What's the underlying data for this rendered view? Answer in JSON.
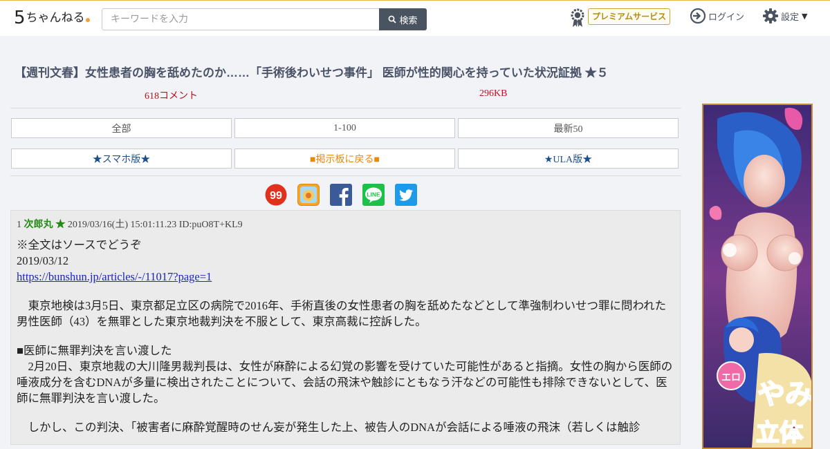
{
  "header": {
    "logo_text": "ちゃんねる",
    "logo_number": "5",
    "search_placeholder": "キーワードを入力",
    "search_button": "検索",
    "premium_label": "プレミアムサービス",
    "login_label": "ログイン",
    "settings_label": "設定"
  },
  "thread": {
    "title": "【週刊文春】女性患者の胸を舐めたのか……「手術後わいせつ事件」 医師が性的関心を持っていた状況証拠 ★５",
    "comments": "618コメント",
    "size": "296KB"
  },
  "nav": {
    "row1": [
      "全部",
      "1-100",
      "最新50"
    ],
    "row2": [
      "★スマホ版★",
      "■掲示板に戻る■",
      "★ULA版★"
    ]
  },
  "social": [
    "99-icon",
    "app-icon",
    "facebook-icon",
    "line-icon",
    "twitter-icon"
  ],
  "post": {
    "number": "1",
    "name": "次郎丸 ★",
    "datetime": "2019/03/16(土) 15:01:11.23",
    "id": "ID:puO8T+KL9",
    "line1": "※全文はソースでどうぞ",
    "line2": "2019/03/12",
    "link": "https://bunshun.jp/articles/-/11017?page=1",
    "para1": "　東京地検は3月5日、東京都足立区の病院で2016年、手術直後の女性患者の胸を舐めたなどとして準強制わいせつ罪に問われた男性医師（43）を無罪とした東京地裁判決を不服として、東京高裁に控訴した。",
    "heading": "■医師に無罪判決を言い渡した",
    "para2": "　2月20日、東京地裁の大川隆男裁判長は、女性が麻酔による幻覚の影響を受けていた可能性があると指摘。女性の胸から医師の唾液成分を含むDNAが多量に検出されたことについて、会話の飛沫や触診にともなう汗などの可能性も排除できないとして、医師に無罪判決を言い渡した。",
    "para3": "　しかし、この判決、「被害者に麻酔覚醒時のせん妄が発生した上、被告人のDNAが会話による唾液の飛沫（若しくは触診"
  },
  "ad": {
    "text": "エロ やみ 立体"
  },
  "colors": {
    "title": "#4b5368",
    "meta_red": "#b3141f",
    "poster_green": "#218a12",
    "link_blue": "#1b24c4",
    "premium_gold": "#b58c12"
  }
}
